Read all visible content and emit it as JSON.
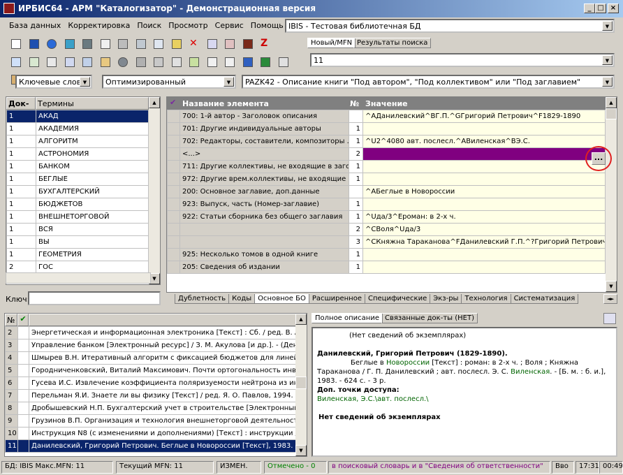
{
  "window": {
    "title": "ИРБИС64 - АРМ \"Каталогизатор\" - Демонстрационная версия",
    "min": "_",
    "max": "□",
    "close": "×"
  },
  "menu": [
    "База данных",
    "Корректировка",
    "Поиск",
    "Просмотр",
    "Сервис",
    "Помощь"
  ],
  "database": {
    "value": "IBIS - Тестовая библиотечная БД"
  },
  "top_tabs": [
    "Новый/MFN",
    "Результаты поиска"
  ],
  "mfn_field": {
    "value": "11"
  },
  "search_bar": {
    "mode": "Ключевые слова",
    "method": "Оптимизированный",
    "worksheet": "PAZK42 - Описание книги \"Под автором\", \"Под коллективом\" или \"Под заглавием\""
  },
  "terms": {
    "headers": [
      "Док-ов",
      "Термины"
    ],
    "rows": [
      [
        "1",
        "АКАД"
      ],
      [
        "1",
        "АКАДЕМИЯ"
      ],
      [
        "1",
        "АЛГОРИТМ"
      ],
      [
        "1",
        "АСТРОНОМИЯ"
      ],
      [
        "1",
        "БАНКОМ"
      ],
      [
        "1",
        "БЕГЛЫЕ"
      ],
      [
        "1",
        "БУХГАЛТЕРСКИЙ"
      ],
      [
        "1",
        "БЮДЖЕТОВ"
      ],
      [
        "1",
        "ВНЕШНЕТОРГОВОЙ"
      ],
      [
        "1",
        "ВСЯ"
      ],
      [
        "1",
        "ВЫ"
      ],
      [
        "1",
        "ГЕОМЕТРИЯ"
      ],
      [
        "2",
        "ГОС"
      ]
    ],
    "key_label": "Ключ:"
  },
  "fields_grid": {
    "headers": [
      "Название элемента",
      "№",
      "Значение"
    ],
    "rows": [
      [
        "700: 1-й автор - Заголовок описания",
        "",
        "^AДанилевский^BГ.П.^GГригорий Петрович^F1829-1890"
      ],
      [
        "701: Другие индивидуальные авторы",
        "1",
        ""
      ],
      [
        "702: Редакторы, составители, композиторы ...",
        "1",
        "^U2^4080 авт. послесл.^AВиленская^BЭ.С."
      ],
      [
        "<...>",
        "2",
        ""
      ],
      [
        "711: Другие коллективы, не входящие в заголо",
        "1",
        ""
      ],
      [
        "972: Другие врем.коллективы, не входящие в з",
        "1",
        ""
      ],
      [
        "200: Основное заглавие, доп.данные",
        "",
        "^AБеглые в Новороссии"
      ],
      [
        "923: Выпуск, часть (Номер-заглавие)",
        "1",
        ""
      ],
      [
        "922: Статьи сборника без общего заглавия",
        "1",
        "^Uда/3^Eроман: в 2-х ч."
      ],
      [
        "",
        "2",
        "^CВоля^Uда/3"
      ],
      [
        "",
        "3",
        "^CКняжна Тараканова^FДанилевский Г.П.^?Григорий Петрович"
      ],
      [
        "925: Несколько томов в одной книге",
        "1",
        ""
      ],
      [
        "205: Сведения об издании",
        "1",
        ""
      ]
    ],
    "ellipsis_button": "..."
  },
  "bottom_tabs": [
    "Дублетность",
    "Коды",
    "Основное БО",
    "Расширенное",
    "Специфические",
    "Экз-ры",
    "Технология",
    "Систематизация"
  ],
  "docs_list": {
    "header": "№",
    "rows": [
      [
        "2",
        "Энергетическая и информационная электроника [Текст] : Сб. / ред. В. А. Л"
      ],
      [
        "3",
        "Управление банком [Электронный ресурс]  / З. М. Акулова [и др.]. - (Деньг"
      ],
      [
        "4",
        "Шмырев В.Н. Итеративный алгоритм с фиксацией бюджетов для линейно"
      ],
      [
        "5",
        "Городниченковский, Виталий Максимович. Почти ортогональность инвари"
      ],
      [
        "6",
        "Гусева И.С. Извлечение коэффициента поляризуемости нейтрона из инт"
      ],
      [
        "7",
        "Перельман Я.И. Знаете ли вы физику [Текст] / ред. Я. О. Павлов, 1994. - 2"
      ],
      [
        "8",
        "Дробышевский Н.П. Бухгалтерский учет в строительстве [Электронный р"
      ],
      [
        "9",
        "Грузинов В.П. Организация и технология внешнеторговой деятельности ["
      ],
      [
        "10",
        "Инструкция N8   (с изменениями и дополнениями) [Текст] : инструкции / Р"
      ],
      [
        "11",
        "Данилевский, Григорий Петрович. Беглые в Новороссии [Текст], 1983. - 62"
      ]
    ]
  },
  "view_tabs": [
    "Полное описание",
    "Связанные док-ты (НЕТ)"
  ],
  "description": {
    "no_copies_top": "(Нет сведений об экземплярах)",
    "author": "Данилевский, Григорий Петрович (1829-1890).",
    "bib_p1": "Беглые в ",
    "bib_link1": "Новороссии",
    "bib_p2": " [Текст] : роман: в 2-х ч. ; Воля ; Княжна Тараканова / Г. П. Данилевский ; авт. послесл. Э. С. ",
    "bib_link2": "Виленская",
    "bib_p3": ". - [Б. м. : б. и.], 1983. - 624 с. - 3 р.",
    "access_title": "Доп. точки доступа:",
    "access_line": "Виленская, Э.С.\\авт. послесл.\\",
    "no_copies_bottom": "Нет сведений об экземплярах"
  },
  "status": {
    "db": "БД: IBIS Макс.MFN: 11",
    "current": "Текущий MFN: 11",
    "changed": "ИЗМЕН.",
    "marked": "Отмечено - 0",
    "message": "в поисковый словарь и в \"Сведения об ответственности\"",
    "vvo": "Вво",
    "time": "17:31",
    "clock": "00:49"
  },
  "colors": {
    "selection": "#0a246a",
    "active_row": "#800080",
    "value_bg": "#ffffe6",
    "grid_header": "#808080",
    "link": "#006400",
    "message": "#800080",
    "marked": "#008000"
  }
}
